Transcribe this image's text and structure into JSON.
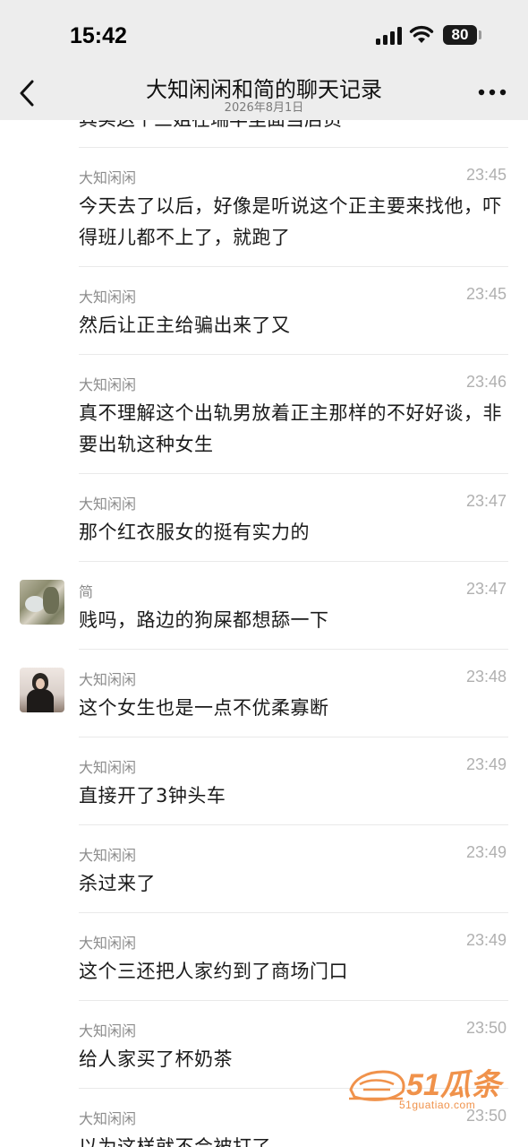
{
  "status_bar": {
    "time": "15:42",
    "battery_level": "80",
    "icons": [
      "signal-icon",
      "wifi-icon",
      "battery-icon"
    ]
  },
  "nav": {
    "title": "大知闲闲和简的聊天记录",
    "subtitle": "2026年8月1日",
    "back_icon": "chevron-left-icon",
    "more_icon": "more-horizontal-icon"
  },
  "partial_message": {
    "text": "其实这个三姐在瑞丰里面当店员"
  },
  "messages": [
    {
      "sender": "大知闲闲",
      "time": "23:45",
      "text": "今天去了以后，好像是听说这个正主要来找他，吓得班儿都不上了，就跑了",
      "avatar": ""
    },
    {
      "sender": "大知闲闲",
      "time": "23:45",
      "text": "然后让正主给骗出来了又",
      "avatar": ""
    },
    {
      "sender": "大知闲闲",
      "time": "23:46",
      "text": "真不理解这个出轨男放着正主那样的不好好谈，非要出轨这种女生",
      "avatar": ""
    },
    {
      "sender": "大知闲闲",
      "time": "23:47",
      "text": "那个红衣服女的挺有实力的",
      "avatar": ""
    },
    {
      "sender": "简",
      "time": "23:47",
      "text": "贱吗，路边的狗屎都想舔一下",
      "avatar": "jian"
    },
    {
      "sender": "大知闲闲",
      "time": "23:48",
      "text": "这个女生也是一点不优柔寡断",
      "avatar": "person"
    },
    {
      "sender": "大知闲闲",
      "time": "23:49",
      "text": "直接开了3钟头车",
      "avatar": ""
    },
    {
      "sender": "大知闲闲",
      "time": "23:49",
      "text": "杀过来了",
      "avatar": ""
    },
    {
      "sender": "大知闲闲",
      "time": "23:49",
      "text": "这个三还把人家约到了商场门口",
      "avatar": ""
    },
    {
      "sender": "大知闲闲",
      "time": "23:50",
      "text": "给人家买了杯奶茶",
      "avatar": ""
    },
    {
      "sender": "大知闲闲",
      "time": "23:50",
      "text": "以为这样就不会被打了",
      "avatar": ""
    }
  ],
  "watermark": {
    "brand": "51瓜条",
    "url": "51guatiao.com"
  },
  "colors": {
    "header_bg": "#ededed",
    "divider": "#e9e9e9",
    "meta_text": "#8c8c8c",
    "time_text": "#b0b0b0",
    "watermark": "#f0924b"
  }
}
